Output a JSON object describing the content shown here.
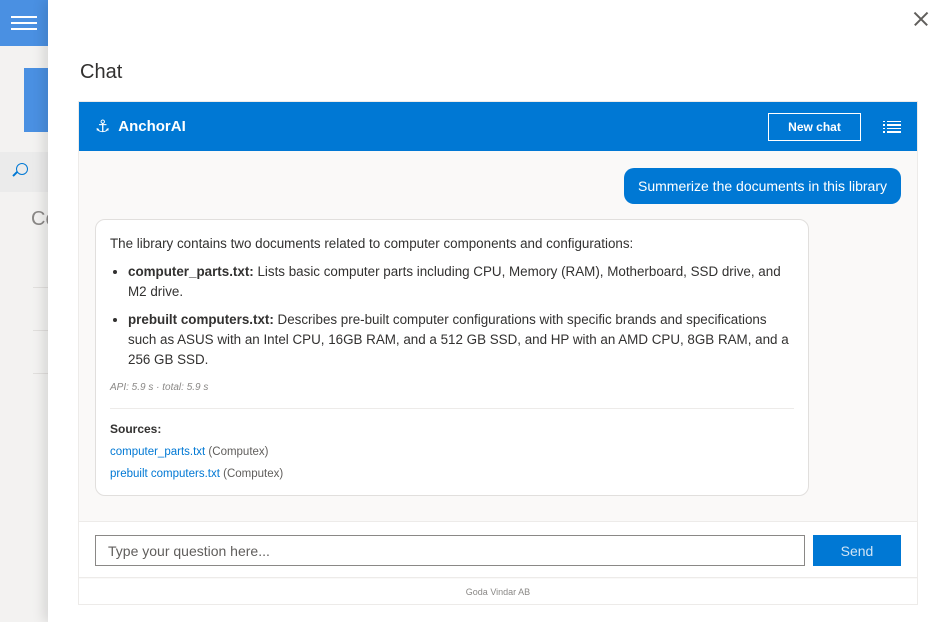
{
  "background": {
    "title_fragment": "Co"
  },
  "panel": {
    "title": "Chat"
  },
  "chat": {
    "brand_name": "AnchorAI",
    "new_chat_label": "New chat",
    "user_message": "Summerize the documents in this library",
    "bot": {
      "intro": "The library contains two documents related to computer components and configurations:",
      "items": [
        {
          "name": "computer_parts.txt:",
          "text": " Lists basic computer parts including CPU, Memory (RAM), Motherboard, SSD drive, and M2 drive."
        },
        {
          "name": "prebuilt computers.txt:",
          "text": " Describes pre-built computer configurations with specific brands and specifications such as ASUS with an Intel CPU, 16GB RAM, and a 512 GB SSD, and HP with an AMD CPU, 8GB RAM, and a 256 GB SSD."
        }
      ],
      "meta": "API: 5.9 s · total: 5.9 s",
      "sources_label": "Sources:",
      "sources": [
        {
          "link": "computer_parts.txt",
          "origin": " (Computex)"
        },
        {
          "link": "prebuilt computers.txt",
          "origin": " (Computex)"
        }
      ]
    },
    "input_placeholder": "Type your question here...",
    "send_label": "Send",
    "footer": "Goda Vindar AB"
  },
  "colors": {
    "accent": "#0078d4",
    "background": "#faf9f8"
  },
  "icons": {
    "menu": "hamburger-icon",
    "search": "search-icon",
    "close": "close-icon",
    "brand": "anchor-icon",
    "history": "list-icon"
  }
}
